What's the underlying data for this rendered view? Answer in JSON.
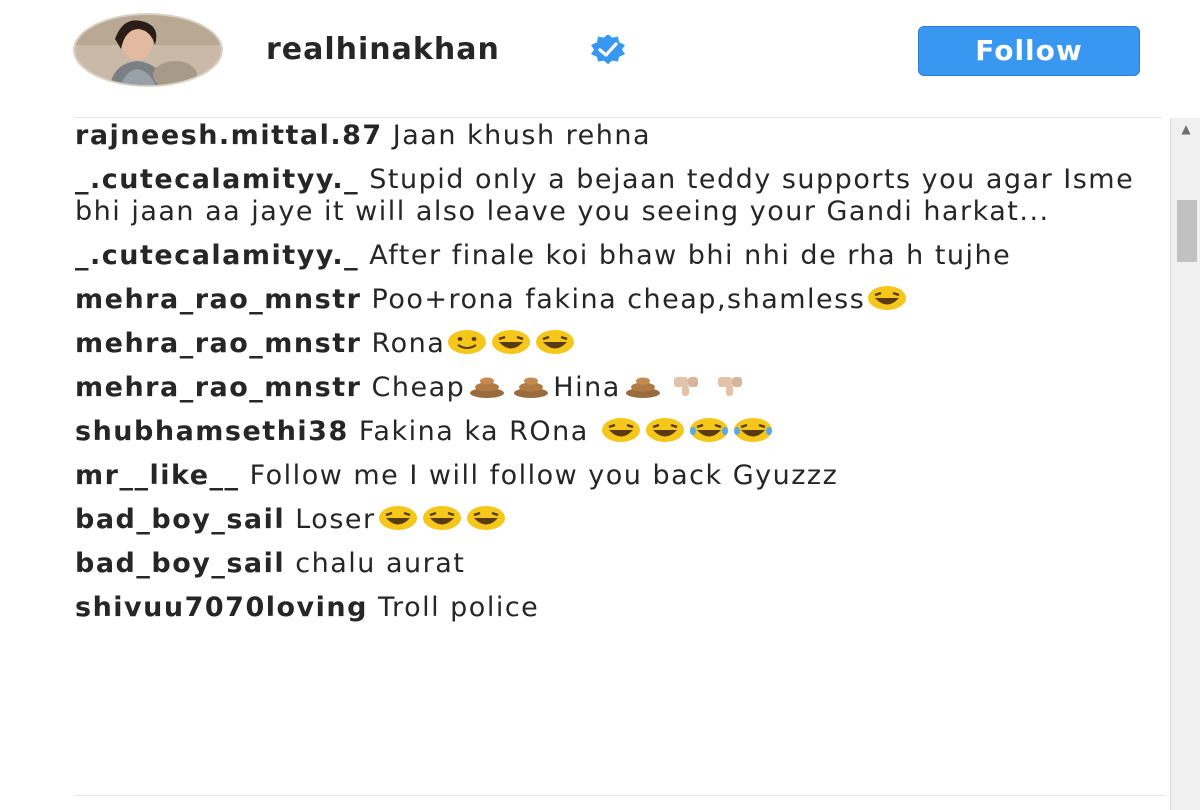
{
  "header": {
    "username": "realhinakhan",
    "follow_label": "Follow",
    "verified_icon": "verified-badge-icon",
    "accent_color": "#3897f0"
  },
  "comments": [
    {
      "user": "rajneesh.mittal.87",
      "segments": [
        {
          "t": "text",
          "v": " Jaan khush rehna"
        }
      ]
    },
    {
      "user": "_.cutecalamityy._",
      "segments": [
        {
          "t": "text",
          "v": " Stupid only a bejaan teddy supports you agar Isme bhi jaan aa jaye it will also leave you seeing your Gandi harkat..."
        }
      ]
    },
    {
      "user": "_.cutecalamityy._",
      "segments": [
        {
          "t": "text",
          "v": " After finale koi bhaw bhi nhi de rha h tujhe"
        }
      ]
    },
    {
      "user": "mehra_rao_mnstr",
      "segments": [
        {
          "t": "text",
          "v": " Poo+rona fakina cheap,shamless"
        },
        {
          "t": "emoji",
          "v": "laughing-face-icon"
        }
      ]
    },
    {
      "user": "mehra_rao_mnstr",
      "segments": [
        {
          "t": "text",
          "v": " Rona"
        },
        {
          "t": "emoji",
          "v": "smiling-face-icon"
        },
        {
          "t": "emoji",
          "v": "laughing-face-icon"
        },
        {
          "t": "emoji",
          "v": "laughing-face-icon"
        }
      ]
    },
    {
      "user": "mehra_rao_mnstr",
      "segments": [
        {
          "t": "text",
          "v": " Cheap"
        },
        {
          "t": "emoji",
          "v": "poop-icon"
        },
        {
          "t": "emoji",
          "v": "poop-icon"
        },
        {
          "t": "text",
          "v": "Hina"
        },
        {
          "t": "emoji",
          "v": "poop-icon"
        },
        {
          "t": "emoji",
          "v": "thumbs-down-icon"
        },
        {
          "t": "emoji",
          "v": "thumbs-down-icon"
        }
      ]
    },
    {
      "user": "shubhamsethi38",
      "segments": [
        {
          "t": "text",
          "v": " Fakina ka ROna "
        },
        {
          "t": "emoji",
          "v": "laughing-face-icon"
        },
        {
          "t": "emoji",
          "v": "laughing-face-icon"
        },
        {
          "t": "emoji",
          "v": "crying-laughing-face-icon"
        },
        {
          "t": "emoji",
          "v": "crying-laughing-face-icon"
        }
      ]
    },
    {
      "user": "mr__like__",
      "segments": [
        {
          "t": "text",
          "v": " Follow me I will follow you back Gyuzzz"
        }
      ]
    },
    {
      "user": "bad_boy_sail",
      "segments": [
        {
          "t": "text",
          "v": " Loser"
        },
        {
          "t": "emoji",
          "v": "laughing-face-icon"
        },
        {
          "t": "emoji",
          "v": "laughing-face-icon"
        },
        {
          "t": "emoji",
          "v": "laughing-face-icon"
        }
      ]
    },
    {
      "user": "bad_boy_sail",
      "segments": [
        {
          "t": "text",
          "v": " chalu aurat"
        }
      ]
    },
    {
      "user": "shivuu7070loving",
      "segments": [
        {
          "t": "text",
          "v": " Troll police"
        }
      ]
    }
  ]
}
